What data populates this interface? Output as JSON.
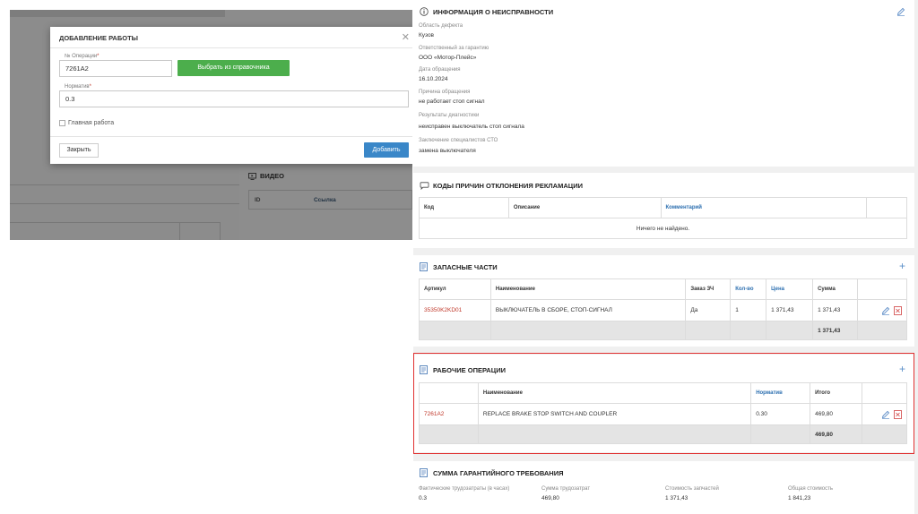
{
  "modal": {
    "title": "ДОБАВЛЕНИЕ РАБОТЫ",
    "op_label": "№ Операции",
    "op_value": "7261A2",
    "pick_button": "Выбрать из справочника",
    "norm_label": "Норматив",
    "norm_value": "0.3",
    "main_work_label": "Главная работа",
    "close_button": "Закрыть",
    "add_button": "Добавить",
    "required_mark": "*"
  },
  "background": {
    "video_title": "ВИДЕО",
    "video_col_id": "ID",
    "video_col_link": "Ссылка"
  },
  "defect": {
    "title": "ИНФОРМАЦИЯ О НЕИСПРАВНОСТИ",
    "fields": [
      {
        "label": "Область дефекта",
        "value": "Кузов"
      },
      {
        "label": "Ответственный за гарантию",
        "value": "ООО «Мотор-Плейс»"
      },
      {
        "label": "Дата обращения",
        "value": "16.10.2024"
      },
      {
        "label": "Причина обращения",
        "value": "не работает стоп сигнал"
      },
      {
        "label": "Результаты диагностики",
        "value": "неисправен выключатель стоп сигнала"
      },
      {
        "label": "Заключение специалистов СТО",
        "value": "замена выключателя"
      }
    ]
  },
  "codes": {
    "title": "КОДЫ ПРИЧИН ОТКЛОНЕНИЯ РЕКЛАМАЦИИ",
    "col_code": "Код",
    "col_desc": "Описание",
    "col_comment": "Комментарий",
    "empty": "Ничего не найдено."
  },
  "parts": {
    "title": "ЗАПАСНЫЕ ЧАСТИ",
    "headers": [
      "Артикул",
      "Наименование",
      "Заказ ЗЧ",
      "Кол-во",
      "Цена",
      "Сумма"
    ],
    "rows": [
      {
        "article": "35350K2KD01",
        "name": "ВЫКЛЮЧАТЕЛЬ В СБОРЕ, СТОП-СИГНАЛ",
        "order": "Да",
        "qty": "1",
        "price": "1 371,43",
        "sum": "1 371,43"
      }
    ],
    "total": "1 371,43"
  },
  "works": {
    "title": "РАБОЧИЕ ОПЕРАЦИИ",
    "headers": [
      "Наименование",
      "Норматив",
      "Итого"
    ],
    "rows": [
      {
        "code": "7261A2",
        "name": "REPLACE BRAKE STOP SWITCH AND COUPLER",
        "norm": "0.30",
        "total": "469,80"
      }
    ],
    "total": "469,80"
  },
  "claim": {
    "title": "СУММА ГАРАНТИЙНОГО ТРЕБОВАНИЯ",
    "items": [
      {
        "label": "Фактические трудозатраты (в часах)",
        "value": "0.3"
      },
      {
        "label": "Сумма трудозатрат",
        "value": "469,80"
      },
      {
        "label": "Стоимость запчастей",
        "value": "1 371,43"
      },
      {
        "label": "Общая стоимость",
        "value": "1 841,23"
      }
    ]
  },
  "colors": {
    "green": "#4cae4c",
    "blue": "#3a87c8",
    "red_arrow": "#e00000",
    "highlight": "#e03030",
    "link_red": "#c0392b"
  }
}
